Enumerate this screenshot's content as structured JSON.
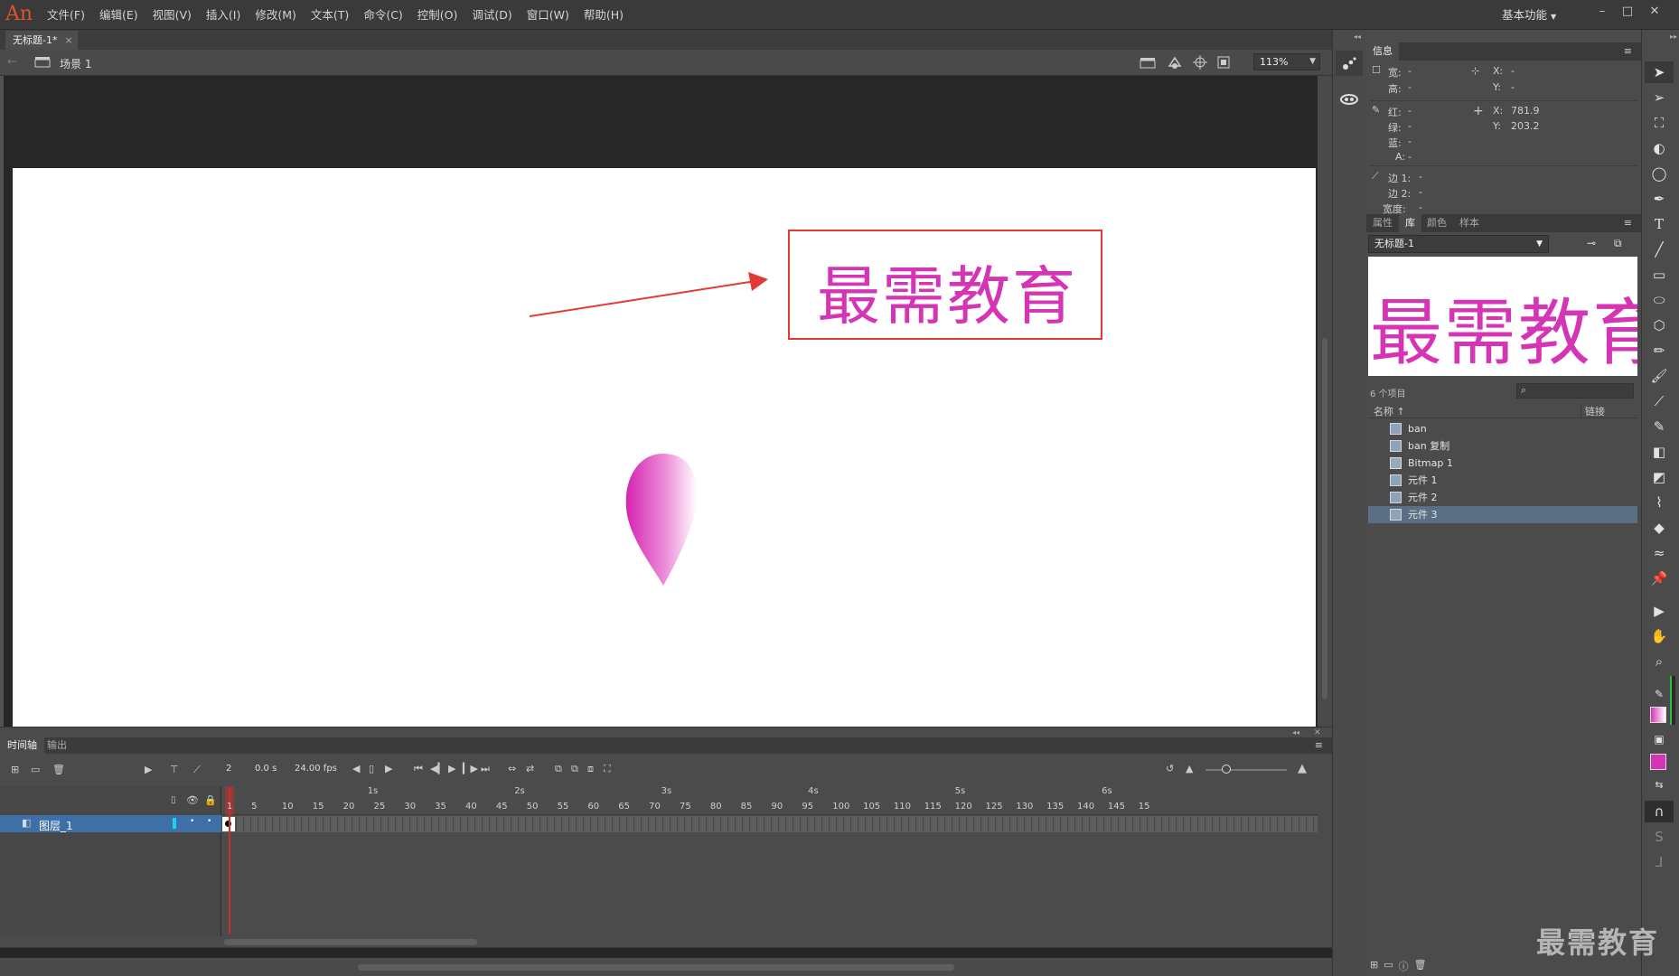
{
  "app": {
    "logo": "An"
  },
  "menu": [
    "文件(F)",
    "编辑(E)",
    "视图(V)",
    "插入(I)",
    "修改(M)",
    "文本(T)",
    "命令(C)",
    "控制(O)",
    "调试(D)",
    "窗口(W)",
    "帮助(H)"
  ],
  "workspace": "基本功能",
  "document_tab": {
    "title": "无标题-1*",
    "close": "×"
  },
  "editbar": {
    "scene": "场景 1",
    "zoom": "113%"
  },
  "stage": {
    "title_text": "最需教育"
  },
  "info_panel": {
    "tab": "信息",
    "width_label": "宽:",
    "width_value": "-",
    "height_label": "高:",
    "height_value": "-",
    "x_label": "X:",
    "x_value": "-",
    "y_label": "Y:",
    "y_value": "-",
    "red_label": "红:",
    "red_value": "-",
    "green_label": "绿:",
    "green_value": "-",
    "blue_label": "蓝:",
    "blue_value": "-",
    "alpha_label": "A:",
    "alpha_value": "-",
    "cursor_x_label": "X:",
    "cursor_x_value": "781.9",
    "cursor_y_label": "Y:",
    "cursor_y_value": "203.2",
    "edge1_label": "边 1:",
    "edge1_value": "-",
    "edge2_label": "边 2:",
    "edge2_value": "-",
    "stroke_label": "宽度:",
    "stroke_value": "-"
  },
  "library_panel": {
    "tabs": [
      "属性",
      "库",
      "颜色",
      "样本"
    ],
    "active_tab": 1,
    "document": "无标题-1",
    "preview_text": "最需教育",
    "item_count": "6 个项目",
    "col_name": "名称",
    "col_link": "链接",
    "items": [
      {
        "name": "ban",
        "type": "graphic"
      },
      {
        "name": "ban 复制",
        "type": "graphic"
      },
      {
        "name": "Bitmap 1",
        "type": "bitmap"
      },
      {
        "name": "元件 1",
        "type": "graphic"
      },
      {
        "name": "元件 2",
        "type": "graphic"
      },
      {
        "name": "元件 3",
        "type": "graphic",
        "selected": true
      }
    ]
  },
  "timeline": {
    "tabs": [
      "时间轴",
      "输出"
    ],
    "current_frame": "2",
    "elapsed": "0.0 s",
    "fps": "24.00 fps",
    "layer_name": "图层_1",
    "frame_ticks": [
      "1",
      "5",
      "10",
      "15",
      "20",
      "25",
      "30",
      "35",
      "40",
      "45",
      "50",
      "55",
      "60",
      "65",
      "70",
      "75",
      "80",
      "85",
      "90",
      "95",
      "100",
      "105",
      "110",
      "115",
      "120",
      "125",
      "130",
      "135",
      "140",
      "145",
      "15"
    ],
    "second_marks": [
      "1s",
      "2s",
      "3s",
      "4s",
      "5s",
      "6s"
    ]
  },
  "watermark": "最需教育",
  "colors": {
    "accent": "#d534b4",
    "stage_bg": "#ffffff",
    "selection": "#3e6fa7",
    "annotation": "#e53935"
  }
}
